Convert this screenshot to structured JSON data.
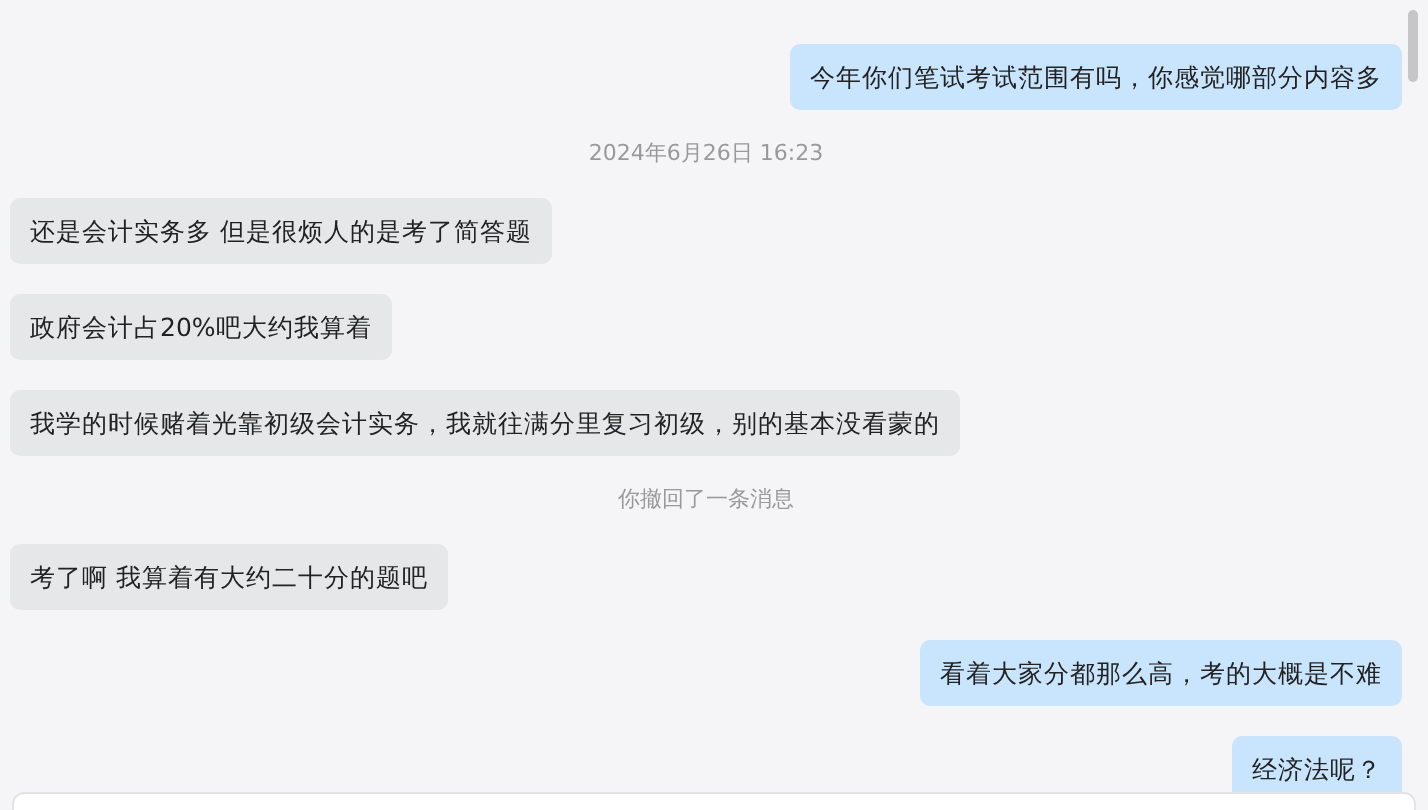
{
  "messages": [
    {
      "kind": "sent",
      "text": "今年你们笔试考试范围有吗，你感觉哪部分内容多"
    },
    {
      "kind": "time",
      "text": "2024年6月26日 16:23"
    },
    {
      "kind": "received",
      "text": "还是会计实务多 但是很烦人的是考了简答题"
    },
    {
      "kind": "received",
      "text": "政府会计占20%吧大约我算着"
    },
    {
      "kind": "received",
      "text": "我学的时候赌着光靠初级会计实务，我就往满分里复习初级，别的基本没看蒙的"
    },
    {
      "kind": "notice",
      "text": "你撤回了一条消息"
    },
    {
      "kind": "received",
      "text": "考了啊 我算着有大约二十分的题吧"
    },
    {
      "kind": "sent",
      "text": "看着大家分都那么高，考的大概是不难"
    },
    {
      "kind": "sent",
      "text": "经济法呢？"
    }
  ]
}
